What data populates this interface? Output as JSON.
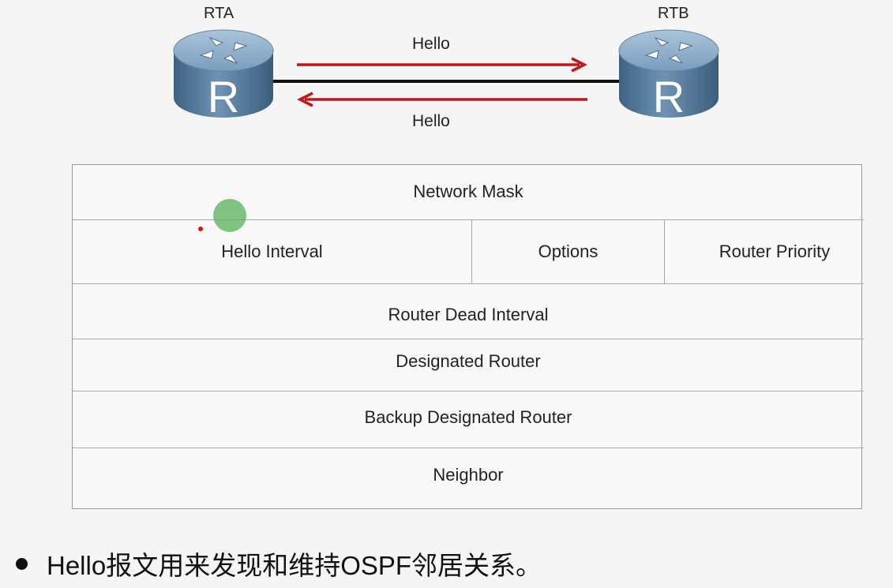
{
  "routers": {
    "left": {
      "label": "RTA",
      "glyph": "R",
      "icon": "router-icon"
    },
    "right": {
      "label": "RTB",
      "glyph": "R",
      "icon": "router-icon"
    }
  },
  "links": {
    "top_arrow_label": "Hello",
    "bottom_arrow_label": "Hello",
    "arrow_color": "#c0171b"
  },
  "packet_fields": {
    "network_mask": "Network Mask",
    "hello_interval": "Hello Interval",
    "options": "Options",
    "router_priority": "Router Priority",
    "router_dead_interval": "Router Dead Interval",
    "designated_router": "Designated Router",
    "backup_designated_router": "Backup Designated Router",
    "neighbor": "Neighbor"
  },
  "bullet": {
    "text": "Hello报文用来发现和维持OSPF邻居关系。"
  },
  "colors": {
    "router_body": "#5b7f9f",
    "router_top": "#8fb0cc"
  }
}
